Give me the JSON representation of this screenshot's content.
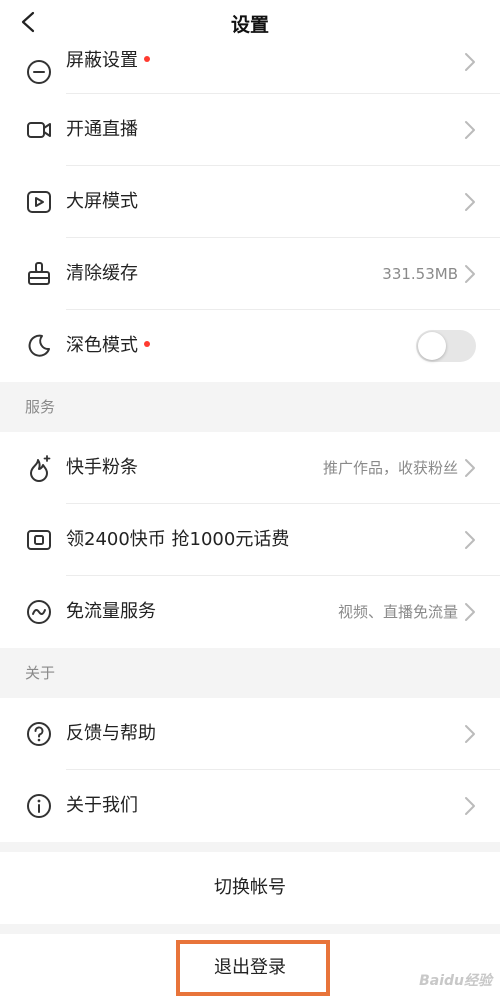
{
  "header": {
    "title": "设置"
  },
  "rows": {
    "block": {
      "label": "屏蔽设置"
    },
    "live": {
      "label": "开通直播"
    },
    "bigscreen": {
      "label": "大屏模式"
    },
    "cache": {
      "label": "清除缓存",
      "value": "331.53MB"
    },
    "dark": {
      "label": "深色模式",
      "enabled": false
    },
    "fans": {
      "label": "快手粉条",
      "value": "推广作品，收获粉丝"
    },
    "coins": {
      "label": "领2400快币 抢1000元话费"
    },
    "dataFree": {
      "label": "免流量服务",
      "value": "视频、直播免流量"
    },
    "feedback": {
      "label": "反馈与帮助"
    },
    "about": {
      "label": "关于我们"
    }
  },
  "sections": {
    "service": "服务",
    "about": "关于"
  },
  "actions": {
    "switch": "切换帐号",
    "logout": "退出登录"
  },
  "watermark": "Baidu经验",
  "colors": {
    "accent_dot": "#ff3b30",
    "highlight_box": "#e8743a"
  }
}
